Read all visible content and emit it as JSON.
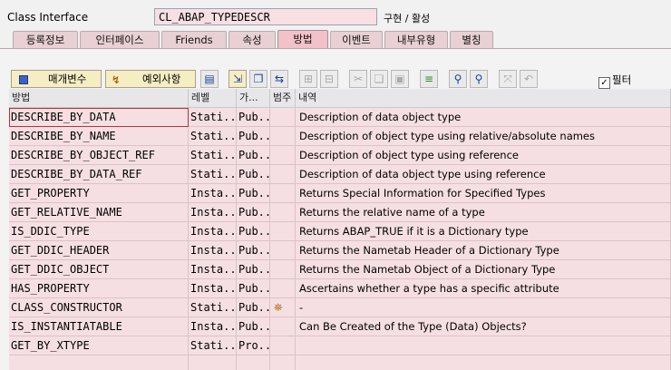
{
  "header": {
    "label": "Class Interface",
    "class_name": "CL_ABAP_TYPEDESCR",
    "status": "구현 / 활성"
  },
  "tabs": [
    {
      "label": "등록정보",
      "active": false
    },
    {
      "label": "인터페이스",
      "active": false
    },
    {
      "label": "Friends",
      "active": false
    },
    {
      "label": "속성",
      "active": false
    },
    {
      "label": "방법",
      "active": true
    },
    {
      "label": "이벤트",
      "active": false
    },
    {
      "label": "내부유형",
      "active": false
    },
    {
      "label": "별칭",
      "active": false
    }
  ],
  "toolbar": {
    "params_label": "매개변수",
    "exceptions_label": "예외사항",
    "filter_label": "필터",
    "filter_checked": true,
    "icons": [
      "source-code-icon",
      "detail-view-icon",
      "copy-row-icon",
      "navigate-icon",
      "insert-row-icon",
      "delete-row-icon",
      "cut-icon",
      "copy-icon",
      "paste-icon",
      "sort-icon",
      "find-icon",
      "find-next-icon",
      "where-used-icon",
      "undo-icon"
    ]
  },
  "table": {
    "columns": [
      "방법",
      "레벨",
      "가...",
      "범주",
      "내역"
    ],
    "rows": [
      {
        "method": "DESCRIBE_BY_DATA",
        "level": "Stati...",
        "visibility": "Pub...",
        "category": "",
        "desc": "Description of data object type"
      },
      {
        "method": "DESCRIBE_BY_NAME",
        "level": "Stati...",
        "visibility": "Pub...",
        "category": "",
        "desc": "Description of object type using relative/absolute names"
      },
      {
        "method": "DESCRIBE_BY_OBJECT_REF",
        "level": "Stati...",
        "visibility": "Pub...",
        "category": "",
        "desc": "Description of object type using reference"
      },
      {
        "method": "DESCRIBE_BY_DATA_REF",
        "level": "Stati...",
        "visibility": "Pub...",
        "category": "",
        "desc": "Description of data object type using reference"
      },
      {
        "method": "GET_PROPERTY",
        "level": "Insta...",
        "visibility": "Pub...",
        "category": "",
        "desc": "Returns Special Information for Specified Types"
      },
      {
        "method": "GET_RELATIVE_NAME",
        "level": "Insta...",
        "visibility": "Pub...",
        "category": "",
        "desc": "Returns the relative name of a type"
      },
      {
        "method": "IS_DDIC_TYPE",
        "level": "Insta...",
        "visibility": "Pub...",
        "category": "",
        "desc": "Returns ABAP_TRUE if it is a Dictionary type"
      },
      {
        "method": "GET_DDIC_HEADER",
        "level": "Insta...",
        "visibility": "Pub...",
        "category": "",
        "desc": "Returns the Nametab Header of a Dictionary Type"
      },
      {
        "method": "GET_DDIC_OBJECT",
        "level": "Insta...",
        "visibility": "Pub...",
        "category": "",
        "desc": "Returns the Nametab Object of a Dictionary Type"
      },
      {
        "method": "HAS_PROPERTY",
        "level": "Insta...",
        "visibility": "Pub...",
        "category": "",
        "desc": "Ascertains whether a type has a specific attribute"
      },
      {
        "method": "CLASS_CONSTRUCTOR",
        "level": "Stati...",
        "visibility": "Pub...",
        "category": "constructor-icon",
        "desc": "-"
      },
      {
        "method": "IS_INSTANTIATABLE",
        "level": "Insta...",
        "visibility": "Pub...",
        "category": "",
        "desc": "Can Be Created of the Type (Data) Objects?"
      },
      {
        "method": "GET_BY_XTYPE",
        "level": "Stati...",
        "visibility": "Pro...",
        "category": "",
        "desc": ""
      },
      {
        "method": "",
        "level": "",
        "visibility": "",
        "category": "",
        "desc": ""
      }
    ]
  }
}
